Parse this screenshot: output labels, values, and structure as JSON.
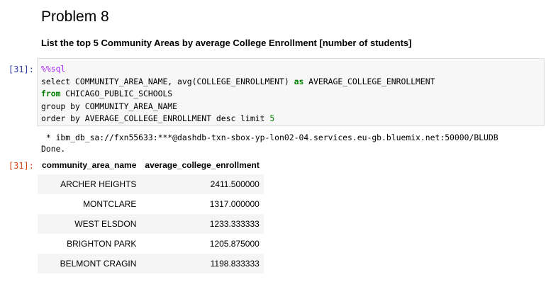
{
  "markdown": {
    "title": "Problem 8",
    "subtitle": "List the top 5 Community Areas by average College Enrollment [number of students]"
  },
  "input_cell": {
    "prompt": "[31]:",
    "lines": [
      [
        {
          "t": "%%sql",
          "c": "magic"
        }
      ],
      [
        {
          "t": "select COMMUNITY_AREA_NAME, avg(COLLEGE_ENROLLMENT) ",
          "c": ""
        },
        {
          "t": "as",
          "c": "kw"
        },
        {
          "t": " AVERAGE_COLLEGE_ENROLLMENT",
          "c": ""
        }
      ],
      [
        {
          "t": "from",
          "c": "kw"
        },
        {
          "t": " CHICAGO_PUBLIC_SCHOOLS",
          "c": ""
        }
      ],
      [
        {
          "t": "group by COMMUNITY_AREA_NAME",
          "c": ""
        }
      ],
      [
        {
          "t": "order by AVERAGE_COLLEGE_ENROLLMENT desc limit ",
          "c": ""
        },
        {
          "t": "5",
          "c": "num"
        }
      ]
    ]
  },
  "stream_output": {
    "line1": " * ibm_db_sa://fxn55633:***@dashdb-txn-sbox-yp-lon02-04.services.eu-gb.bluemix.net:50000/BLUDB",
    "line2": "Done."
  },
  "output_cell": {
    "prompt": "[31]:",
    "headers": [
      "community_area_name",
      "average_college_enrollment"
    ],
    "rows": [
      [
        "ARCHER HEIGHTS",
        "2411.500000"
      ],
      [
        "MONTCLARE",
        "1317.000000"
      ],
      [
        "WEST ELSDON",
        "1233.333333"
      ],
      [
        "BRIGHTON PARK",
        "1205.875000"
      ],
      [
        "BELMONT CRAGIN",
        "1198.833333"
      ]
    ]
  },
  "colors": {
    "in_prompt": "#303f9f",
    "out_prompt": "#d84315",
    "magic": "#aa22ff",
    "keyword": "#008000",
    "code_bg": "#f7f7f7",
    "row_stripe": "#f5f5f5"
  }
}
